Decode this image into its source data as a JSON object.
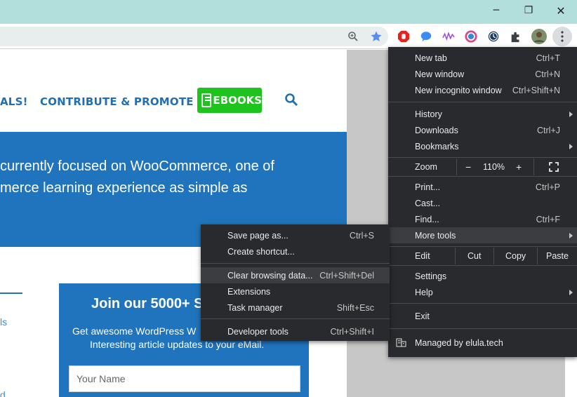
{
  "window_controls": {
    "minimize": "─",
    "restore": "❐",
    "close": "✕"
  },
  "page": {
    "nav": {
      "fragment": "ALS!",
      "contribute": "CONTRIBUTE & PROMOTE",
      "ebooks": "EBOOKS"
    },
    "intro_line1": "currently focused on WooCommerce, one of",
    "intro_line2": "merce learning experience as simple as",
    "left_fragments": [
      "ls",
      "d"
    ],
    "subscribe": {
      "title": "Join our 5000+ S",
      "text1": "Get awesome WordPress W",
      "text2": "Interesting article updates to your eMail.",
      "name_placeholder": "Your Name"
    }
  },
  "menu": {
    "new_tab": {
      "label": "New tab",
      "shortcut": "Ctrl+T"
    },
    "new_window": {
      "label": "New window",
      "shortcut": "Ctrl+N"
    },
    "new_incognito": {
      "label": "New incognito window",
      "shortcut": "Ctrl+Shift+N"
    },
    "history": {
      "label": "History"
    },
    "downloads": {
      "label": "Downloads",
      "shortcut": "Ctrl+J"
    },
    "bookmarks": {
      "label": "Bookmarks"
    },
    "zoom": {
      "label": "Zoom",
      "minus": "−",
      "level": "110%",
      "plus": "+"
    },
    "print": {
      "label": "Print...",
      "shortcut": "Ctrl+P"
    },
    "cast": {
      "label": "Cast..."
    },
    "find": {
      "label": "Find...",
      "shortcut": "Ctrl+F"
    },
    "more_tools": {
      "label": "More tools"
    },
    "edit": {
      "label": "Edit",
      "cut": "Cut",
      "copy": "Copy",
      "paste": "Paste"
    },
    "settings": {
      "label": "Settings"
    },
    "help": {
      "label": "Help"
    },
    "exit": {
      "label": "Exit"
    },
    "managed": {
      "label": "Managed by elula.tech"
    }
  },
  "submenu": {
    "save_page": {
      "label": "Save page as...",
      "shortcut": "Ctrl+S"
    },
    "create_shortcut": {
      "label": "Create shortcut..."
    },
    "clear_browsing": {
      "label": "Clear browsing data...",
      "shortcut": "Ctrl+Shift+Del"
    },
    "extensions": {
      "label": "Extensions"
    },
    "task_manager": {
      "label": "Task manager",
      "shortcut": "Shift+Esc"
    },
    "dev_tools": {
      "label": "Developer tools",
      "shortcut": "Ctrl+Shift+I"
    }
  },
  "colors": {
    "titlebar": "#b2dfdb",
    "menu_bg": "#292a2d",
    "highlight": "#3c3d41",
    "brand_blue": "#1f74bd",
    "ebooks_green": "#1ec31e"
  }
}
